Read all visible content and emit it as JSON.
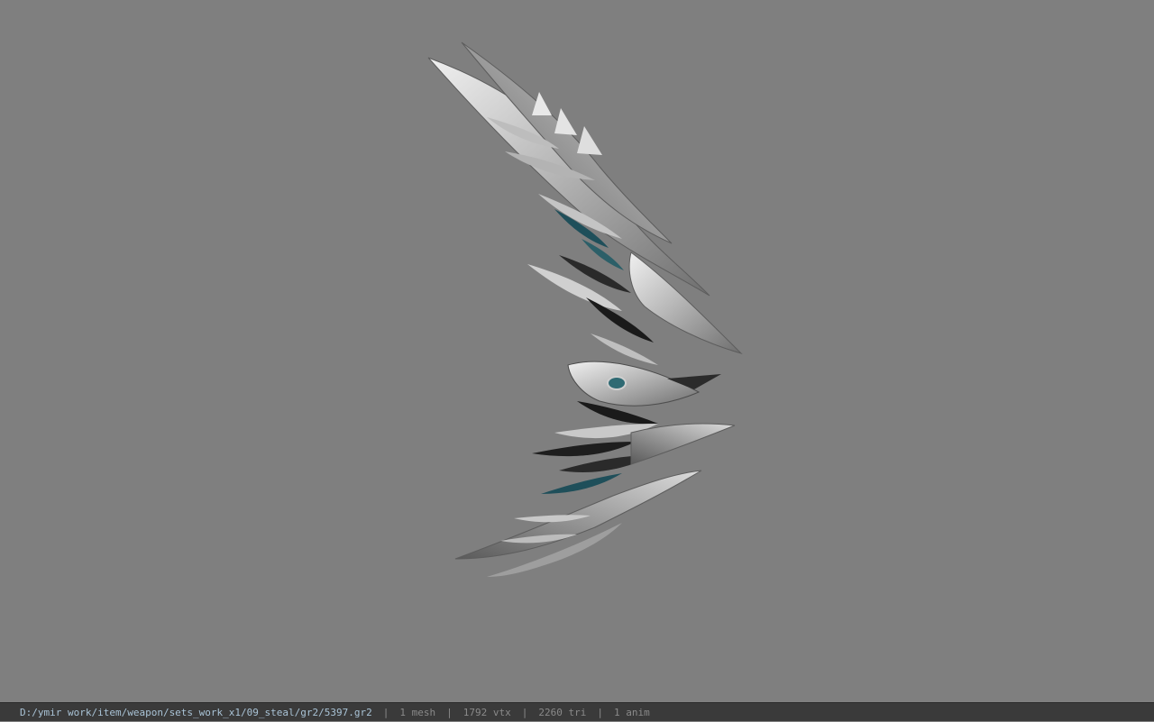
{
  "viewport": {
    "background": "#7f7f7f",
    "model_name": "weapon-model"
  },
  "status": {
    "path": "D:/ymir work/item/weapon/sets_work_x1/09_steal/gr2/5397.gr2",
    "sep": "|",
    "mesh": "1 mesh",
    "vtx": "1792 vtx",
    "tri": "2260 tri",
    "anim": "1 anim"
  },
  "colors": {
    "statusbar_bg": "#3a3a3a",
    "path_text": "#a9c3d6",
    "stat_text": "#8a8a8a"
  }
}
